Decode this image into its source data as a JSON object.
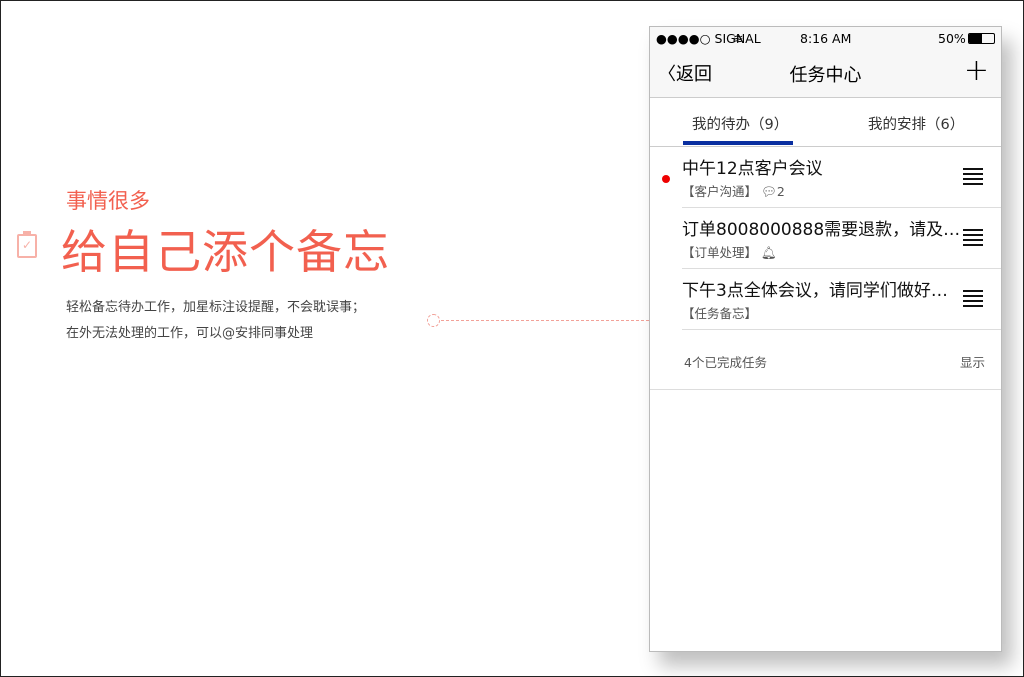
{
  "promo": {
    "subtitle": "事情很多",
    "title": "给自己添个备忘",
    "desc1": "轻松备忘待办工作，加星标注设提醒，不会耽误事；",
    "desc2": "在外无法处理的工作，可以@安排同事处理"
  },
  "status": {
    "signal": "●●●●○ SIGNAL",
    "time": "8:16 AM",
    "battery": "50%"
  },
  "nav": {
    "back": "返回",
    "title": "任务中心",
    "add": "+"
  },
  "tabs": [
    {
      "label": "我的待办（9）"
    },
    {
      "label": "我的安排（6）"
    }
  ],
  "tasks": [
    {
      "title": "中午12点客户会议",
      "category": "【客户沟通】",
      "comments": "2"
    },
    {
      "title": "订单8008000888需要退款，请及…",
      "category": "【订单处理】"
    },
    {
      "title": "下午3点全体会议，请同学们做好…",
      "category": "【任务备忘】"
    }
  ],
  "completed": {
    "label": "4个已完成任务",
    "action": "显示"
  },
  "colors": {
    "accent": "#f2604f",
    "tab_indicator": "#0a2fa0",
    "unread": "#ee0000"
  }
}
